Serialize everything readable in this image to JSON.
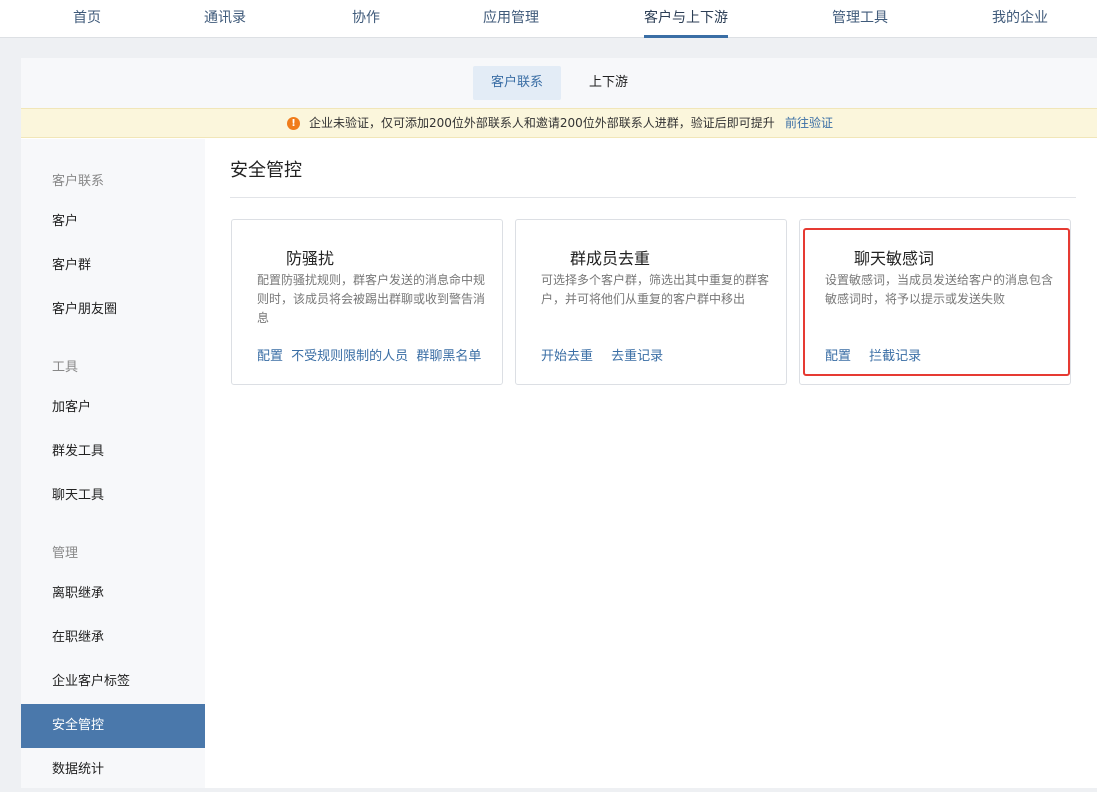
{
  "topnav": {
    "items": [
      {
        "label": "首页"
      },
      {
        "label": "通讯录"
      },
      {
        "label": "协作"
      },
      {
        "label": "应用管理"
      },
      {
        "label": "客户与上下游",
        "active": true
      },
      {
        "label": "管理工具"
      },
      {
        "label": "我的企业"
      }
    ]
  },
  "subtabs": [
    {
      "label": "客户联系",
      "active": true
    },
    {
      "label": "上下游"
    }
  ],
  "notice": {
    "text": "企业未验证，仅可添加200位外部联系人和邀请200位外部联系人进群，验证后即可提升",
    "link": "前往验证",
    "icon": "warning-icon"
  },
  "sidebar": {
    "groups": [
      {
        "title": "客户联系",
        "items": [
          "客户",
          "客户群",
          "客户朋友圈"
        ]
      },
      {
        "title": "工具",
        "items": [
          "加客户",
          "群发工具",
          "聊天工具"
        ]
      },
      {
        "title": "管理",
        "items": [
          "离职继承",
          "在职继承",
          "企业客户标签",
          "安全管控",
          "数据统计"
        ]
      }
    ],
    "active": "安全管控"
  },
  "content": {
    "title": "安全管控",
    "cards": [
      {
        "title": "防骚扰",
        "desc": "配置防骚扰规则，群客户发送的消息命中规则时，该成员将会被踢出群聊或收到警告消息",
        "links": [
          "配置",
          "不受规则限制的人员",
          "群聊黑名单"
        ]
      },
      {
        "title": "群成员去重",
        "desc": "可选择多个客户群，筛选出其中重复的群客户，并可将他们从重复的客户群中移出",
        "links": [
          "开始去重",
          "去重记录"
        ]
      },
      {
        "title": "聊天敏感词",
        "desc": "设置敏感词，当成员发送给客户的消息包含敏感词时，将予以提示或发送失败",
        "links": [
          "配置",
          "拦截记录"
        ]
      }
    ]
  },
  "colors": {
    "accent": "#3a6ea5",
    "sidebar_active": "#4a78ab",
    "highlight": "#e63a32",
    "warning": "#f07c1b"
  }
}
